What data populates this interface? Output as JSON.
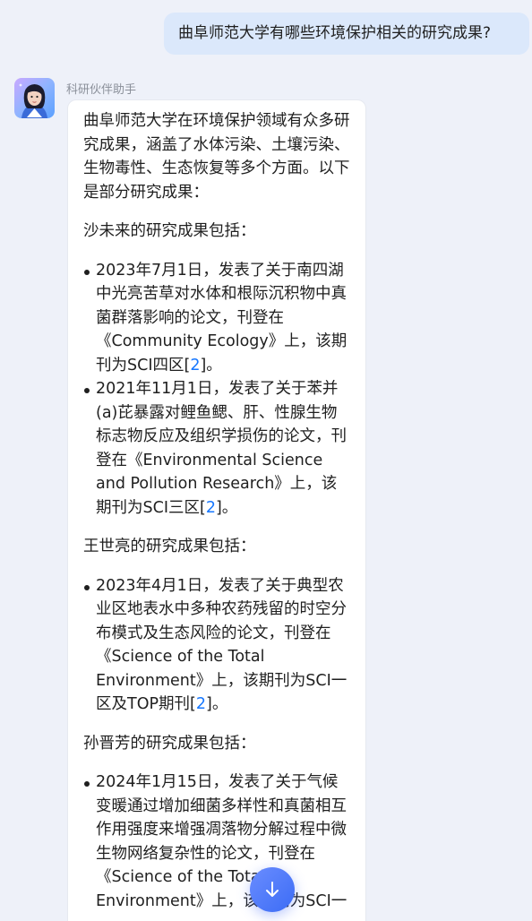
{
  "user_message": "曲阜师范大学有哪些环境保护相关的研究成果?",
  "assistant": {
    "name": "科研伙伴助手",
    "intro": "曲阜师范大学在环境保护领域有众多研究成果，涵盖了水体污染、土壤污染、生物毒性、生态恢复等多个方面。以下是部分研究成果：",
    "sections": [
      {
        "person": "沙未来的研究成果包括：",
        "items": [
          {
            "text": "2023年7月1日，发表了关于南四湖中光亮苦草对水体和根际沉积物中真菌群落影响的论文，刊登在《Community Ecology》上，该期刊为SCI四区[",
            "cite": "2",
            "end": "]。"
          },
          {
            "text": "2021年11月1日，发表了关于苯并(a)芘暴露对鲤鱼鳃、肝、性腺生物标志物反应及组织学损伤的论文，刊登在《Environmental Science and Pollution Research》上，该期刊为SCI三区[",
            "cite": "2",
            "end": "]。"
          }
        ]
      },
      {
        "person": "王世亮的研究成果包括：",
        "items": [
          {
            "text": "2023年4月1日，发表了关于典型农业区地表水中多种农药残留的时空分布模式及生态风险的论文，刊登在《Science of the Total Environment》上，该期刊为SCI一区及TOP期刊[",
            "cite": "2",
            "end": "]。"
          }
        ]
      },
      {
        "person": "孙晋芳的研究成果包括：",
        "items": [
          {
            "text": "2024年1月15日，发表了关于气候变暖通过增加细菌多样性和真菌相互作用强度来增强凋落物分解过程中微生物网络复杂性的论文，刊登在《Science of the Total Environment》上，该期刊为SCI一",
            "cite": "",
            "end": ""
          }
        ]
      }
    ]
  },
  "icons": {
    "avatar": "assistant-avatar",
    "scroll_down": "arrow-down-icon"
  },
  "colors": {
    "user_bubble": "#dbe8fb",
    "citation": "#1677ff",
    "scroll_button": "#4a76f7"
  }
}
